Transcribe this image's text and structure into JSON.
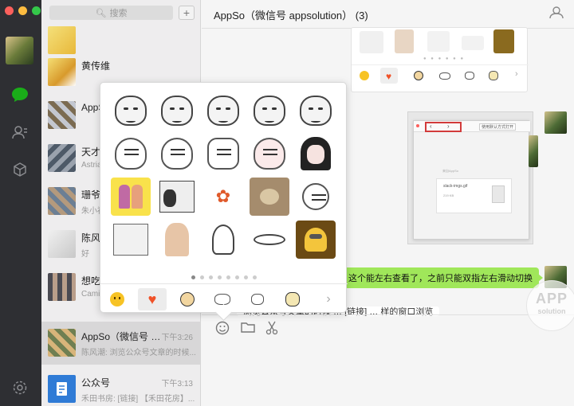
{
  "window": {
    "title": "AppSo（微信号 appsolution） (3)"
  },
  "search": {
    "placeholder": "搜索"
  },
  "conversations": [
    {
      "name": "黄传维",
      "time": "",
      "preview": ""
    },
    {
      "name": "AppSo",
      "time": "",
      "preview": ""
    },
    {
      "name": "天才",
      "time": "",
      "preview": "Astria"
    },
    {
      "name": "珊爷",
      "time": "",
      "preview": "朱小福"
    },
    {
      "name": "陈风",
      "time": "",
      "preview": "好"
    },
    {
      "name": "想吃",
      "time": "",
      "preview": "Camil"
    },
    {
      "name": "AppSo（微信号 ap...",
      "time": "下午3:26",
      "preview": "陈风潮: 浏览公众号文章的时候..."
    },
    {
      "name": "公众号",
      "time": "下午3:13",
      "preview": "禾田书房: [链接] 【禾田花房】..."
    }
  ],
  "messages": {
    "green_bubble": "这个能左右查看了，之前只能双指左右滑动切换",
    "cut_text": "浏览公众号文章的时候 … [链接] … 样的窗口浏览"
  },
  "screenshot": {
    "open_button": "使用默认方式打开",
    "file_name": "slack-imgs.gif",
    "file_size": "219 KB",
    "source": "来自AppSo"
  },
  "sticker_pager": {
    "pages": 8,
    "current": 1
  },
  "watermark": {
    "line1": "APP",
    "line2": "solution"
  },
  "colors": {
    "rail": "#2e2f33",
    "accent_green": "#1aad19",
    "bubble_green": "#a0e75a",
    "heart": "#f05228"
  }
}
